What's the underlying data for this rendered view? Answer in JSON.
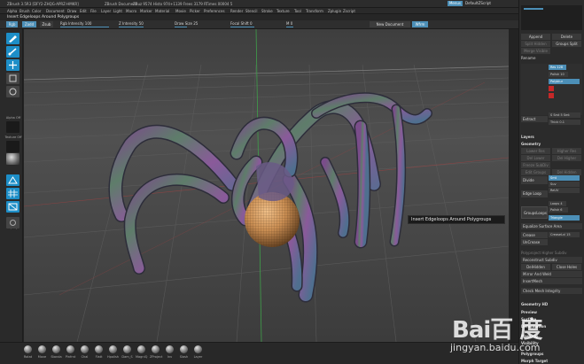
{
  "titlebar": {
    "app": "ZBrush 3.5R3 [DFY2-ZHQG-APRZ-HMKR]",
    "doc": "ZBrush Document",
    "stats": "ZBuz 9574 Histo 974+1139 Frees 3179 RTimes 00004 5",
    "menus_label": "Menus",
    "script_label": "DefaultZScript"
  },
  "menubar": {
    "items": [
      "Alpha",
      "Brush",
      "Color",
      "Document",
      "Draw",
      "Edit",
      "File",
      "Layer",
      "Light",
      "Macro",
      "Marker",
      "Material",
      "Movie",
      "Picker",
      "Preferences",
      "Render",
      "Stencil",
      "Stroke",
      "Texture",
      "Tool",
      "Transform",
      "Zplugin",
      "Zscript"
    ]
  },
  "notebar": {
    "text": "Insert Edgeloops Around Polygroups"
  },
  "toolbar": {
    "rgb_label": "Rgb",
    "zadd_label": "Zadd",
    "zsub_label": "Zsub",
    "rgb_intensity": "Rgb Intensity 100",
    "z_intensity": "Z Intensity 50",
    "draw_size": "Draw Size 25",
    "focal_shift": "Focal Shift 0",
    "m_label": "M 0",
    "new_document": "New Document",
    "wire_label": "Wfrm"
  },
  "leftshelf": {
    "labels": [
      "Alpha Off",
      "Texture Off",
      "Spray",
      "Mod"
    ]
  },
  "viewport": {
    "tooltip": "Insert Edgeloops Around Polygroups"
  },
  "tray": {
    "rows": [
      {
        "type": "half",
        "left": "Append",
        "right": "Delete"
      },
      {
        "type": "half",
        "left": "Split Hidden",
        "right": "Groups Split"
      },
      {
        "type": "half",
        "left": "Merge Visible",
        "right": ""
      },
      {
        "type": "row",
        "label": "Rename"
      },
      {
        "type": "row",
        "label": "AutoReorder"
      }
    ],
    "subtool_box": {
      "res_label": "Res 128",
      "polish_label": "Polish 10",
      "polyblur": "Polyblur",
      "extract": "Extract",
      "smt": "S Smt 5 Smt",
      "thick": "Thick 0.1"
    },
    "layers": "Layers",
    "geometry": "Geometry",
    "geo_rows": [
      {
        "left": "Lower Res",
        "right": "Higher Res"
      },
      {
        "left": "Del Lower",
        "right": "Del Higher"
      },
      {
        "left": "Freeze SubDiv",
        "right": ""
      },
      {
        "left": "Edit Groups",
        "right": "Del Hidden"
      }
    ],
    "divide": "Divide",
    "smt": "Smt",
    "suv": "Suv",
    "rsmt": "ReUV",
    "edge_loop": "Edge Loop",
    "groups_loops": "GroupsLoops",
    "loops": "Loops 4",
    "polish": "Polish 6",
    "triangle": "Triangle",
    "equalize": "Equalize Surface Area",
    "crease": "Crease",
    "crease_level": "CreaseLvl 15",
    "uncrease": "UnCrease",
    "polygroups_subdiv": "Polyproject Higher Subdiv",
    "reconstruct": "Reconstruct Subdiv",
    "del_hidden": "DelHidden",
    "close_holes": "Close Holes",
    "mirror_weld": "Mirror And Weld",
    "insert_mesh": "InsertMesh",
    "check_mesh": "Check Mesh Integrity",
    "geometry_hd": "Geometry HD",
    "preview": "Preview",
    "surface": "Surface",
    "deformation": "Deformation",
    "masking": "Masking",
    "visibility": "Visibility",
    "polygroups": "Polygroups",
    "morph_target": "Morph Target"
  },
  "bottomshelf": {
    "brushes": [
      "Rotat",
      "Move",
      "Standa",
      "Pinfrnt",
      "Chal",
      "Flatt",
      "Hpolish",
      "Dam_S",
      "MagniQ",
      "ZProject",
      "Inv",
      "Slash",
      "Layer"
    ]
  },
  "watermark": {
    "logo": "Bai百 度",
    "url": "jingyan.baidu.com"
  },
  "colors": {
    "accent": "#4c8fb7",
    "active_tool": "#1d8ec7",
    "crease_red": "#c62828",
    "clay": "#c98d52"
  }
}
